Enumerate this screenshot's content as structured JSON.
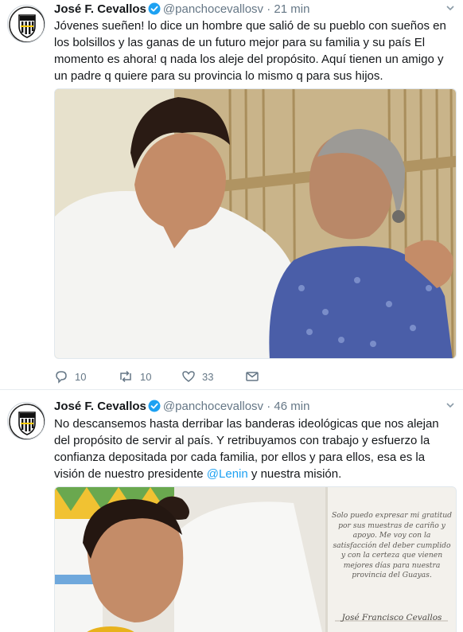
{
  "tweets": [
    {
      "author_name": "José F. Cevallos",
      "handle": "@panchocevallosv",
      "separator": "·",
      "time": "21 min",
      "text": "Jóvenes sueñen! lo dice un hombre que salió de su pueblo con sueños en los bolsillos y las ganas de un futuro mejor para su familia y su país El momento es ahora! q nada los aleje del propósito. Aquí tienen un amigo y un padre q quiere para su provincia lo mismo q para sus hijos.",
      "actions": {
        "replies": "10",
        "retweets": "10",
        "likes": "33"
      }
    },
    {
      "author_name": "José F. Cevallos",
      "handle": "@panchocevallosv",
      "separator": "·",
      "time": "46 min",
      "text_before_mention": "No descansemos hasta derribar las banderas ideológicas que nos alejan del propósito de servir al país. Y retribuyamos con trabajo y esfuerzo la confianza depositada por cada familia, por ellos y para ellos, esa es la visión de nuestro presidente ",
      "mention": "@Lenin",
      "text_after_mention": " y nuestra misión.",
      "image_card": {
        "text": "Solo puedo expresar mi gratitud por sus muestras de cariño y apoyo. Me voy con la satisfacción del deber cumplido y con la certeza que vienen mejores días para nuestra provincia del Guayas.",
        "signature": "José Francisco Cevallos"
      }
    }
  ],
  "icons": {
    "verified": "verified-badge-icon",
    "reply": "speech-bubble-icon",
    "retweet": "retweet-arrows-icon",
    "like": "heart-icon",
    "dm": "envelope-icon",
    "more": "chevron-down-icon"
  },
  "colors": {
    "text": "#14171a",
    "secondary": "#657786",
    "link": "#1da1f2",
    "verified": "#1da1f2",
    "divider": "#e6ecf0"
  }
}
